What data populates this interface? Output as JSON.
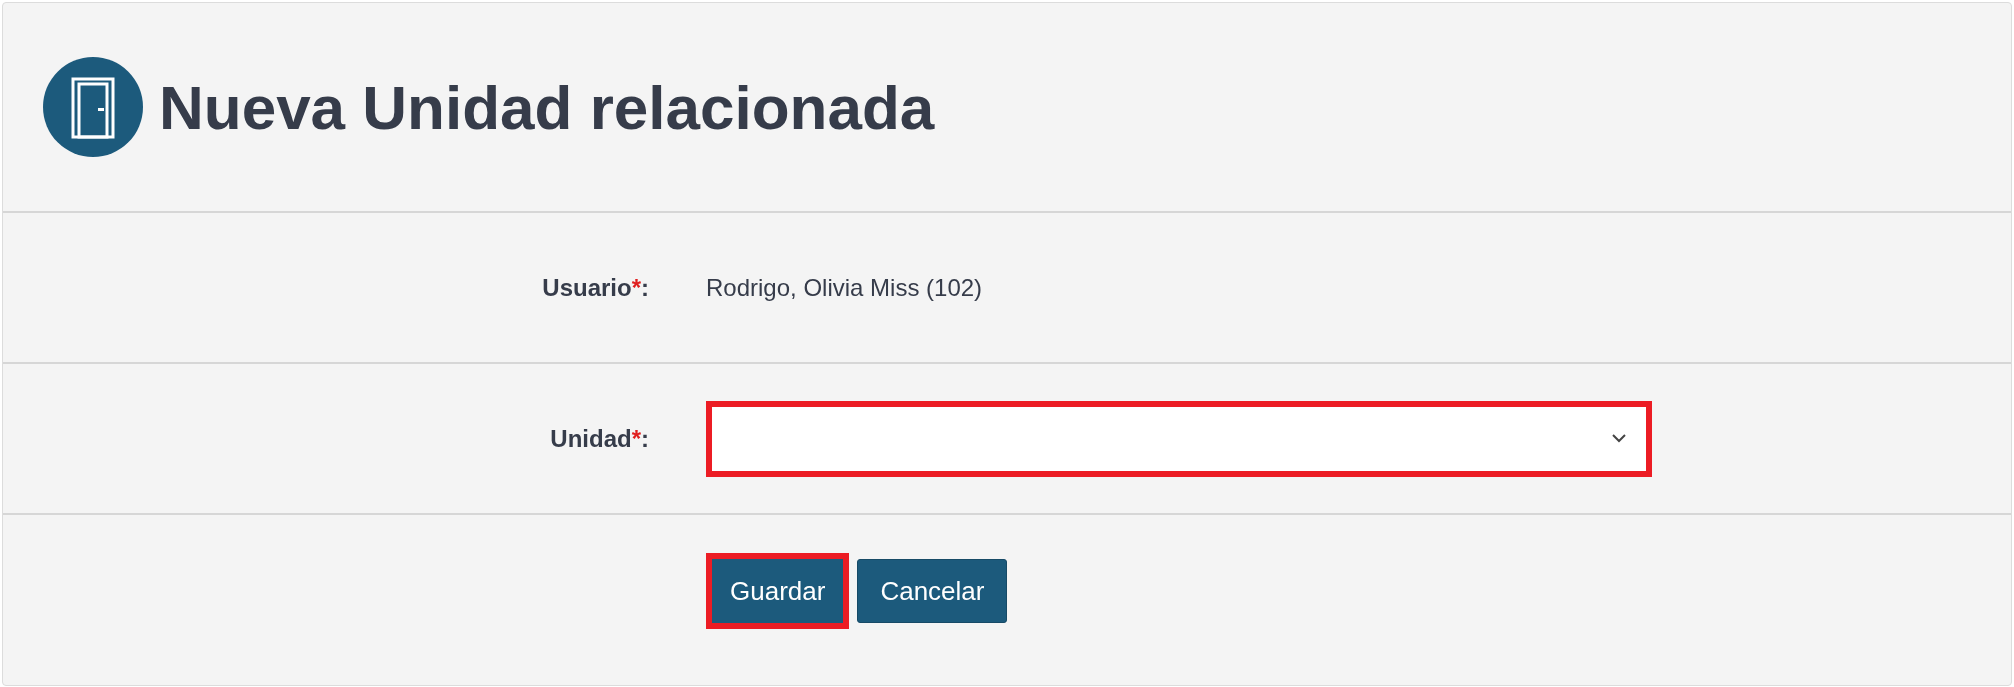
{
  "header": {
    "title": "Nueva Unidad relacionada"
  },
  "fields": [
    {
      "kind": "text",
      "label": "Usuario",
      "required_mark": "*",
      "colon": ":",
      "value": "Rodrigo, Olivia Miss (102)"
    },
    {
      "kind": "select",
      "label": "Unidad",
      "required_mark": "*",
      "colon": ":",
      "highlighted": true
    }
  ],
  "buttons": [
    {
      "label": "Guardar",
      "highlighted": true
    },
    {
      "label": "Cancelar",
      "highlighted": false
    }
  ]
}
